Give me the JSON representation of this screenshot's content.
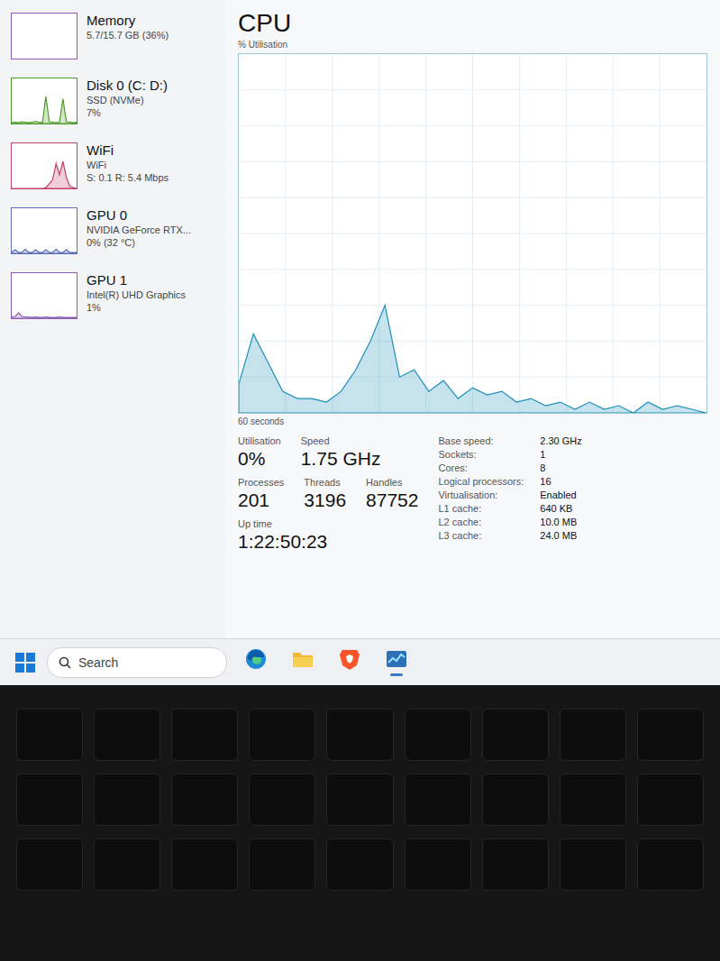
{
  "sidebar": {
    "items": [
      {
        "title": "Memory",
        "lines": [
          "5.7/15.7 GB (36%)"
        ],
        "color": "#8e5cb5",
        "selected": false,
        "graph": []
      },
      {
        "title": "Disk 0 (C: D:)",
        "lines": [
          "SSD (NVMe)",
          "7%"
        ],
        "color": "#4d9a2a",
        "selected": false,
        "graph": [
          2,
          3,
          2,
          4,
          3,
          2,
          3,
          5,
          3,
          2,
          60,
          4,
          3,
          2,
          3,
          55,
          4,
          3,
          2,
          3
        ]
      },
      {
        "title": "WiFi",
        "lines": [
          "WiFi",
          "S: 0.1 R: 5.4 Mbps"
        ],
        "color": "#c2416a",
        "selected": false,
        "graph": [
          0,
          0,
          0,
          0,
          0,
          0,
          0,
          0,
          0,
          0,
          2,
          10,
          20,
          55,
          30,
          60,
          25,
          5,
          2,
          0
        ]
      },
      {
        "title": "GPU 0",
        "lines": [
          "NVIDIA GeForce RTX...",
          "0% (32 °C)"
        ],
        "color": "#5a6db5",
        "selected": false,
        "graph": [
          2,
          8,
          2,
          2,
          9,
          2,
          2,
          8,
          2,
          2,
          8,
          2,
          2,
          9,
          2,
          2,
          8,
          2,
          2,
          2
        ]
      },
      {
        "title": "GPU 1",
        "lines": [
          "Intel(R) UHD Graphics",
          "1%"
        ],
        "color": "#8e5cb5",
        "selected": false,
        "graph": [
          3,
          4,
          12,
          4,
          3,
          3,
          2,
          3,
          2,
          2,
          3,
          2,
          2,
          2,
          3,
          2,
          2,
          2,
          2,
          2
        ]
      }
    ]
  },
  "main": {
    "title": "CPU",
    "axis_label": "% Utilisation",
    "time_label": "60 seconds",
    "series": [
      8,
      22,
      14,
      6,
      4,
      4,
      3,
      6,
      12,
      20,
      30,
      10,
      12,
      6,
      9,
      4,
      7,
      5,
      6,
      3,
      4,
      2,
      3,
      1,
      3,
      1,
      2,
      0,
      3,
      1,
      2,
      1,
      0
    ]
  },
  "stats": {
    "primary": [
      {
        "label": "Utilisation",
        "value": "0%"
      },
      {
        "label": "Speed",
        "value": "1.75 GHz"
      }
    ],
    "secondary": [
      {
        "label": "Processes",
        "value": "201"
      },
      {
        "label": "Threads",
        "value": "3196"
      },
      {
        "label": "Handles",
        "value": "87752"
      }
    ],
    "uptime": {
      "label": "Up time",
      "value": "1:22:50:23"
    }
  },
  "specs": [
    {
      "label": "Base speed:",
      "value": "2.30 GHz"
    },
    {
      "label": "Sockets:",
      "value": "1"
    },
    {
      "label": "Cores:",
      "value": "8"
    },
    {
      "label": "Logical processors:",
      "value": "16"
    },
    {
      "label": "Virtualisation:",
      "value": "Enabled"
    },
    {
      "label": "L1 cache:",
      "value": "640 KB"
    },
    {
      "label": "L2 cache:",
      "value": "10.0 MB"
    },
    {
      "label": "L3 cache:",
      "value": "24.0 MB"
    }
  ],
  "taskbar": {
    "search_placeholder": "Search",
    "apps": [
      {
        "kind": "edge",
        "active": false
      },
      {
        "kind": "explorer",
        "active": false
      },
      {
        "kind": "brave",
        "active": false
      },
      {
        "kind": "taskmgr",
        "active": true
      }
    ]
  }
}
